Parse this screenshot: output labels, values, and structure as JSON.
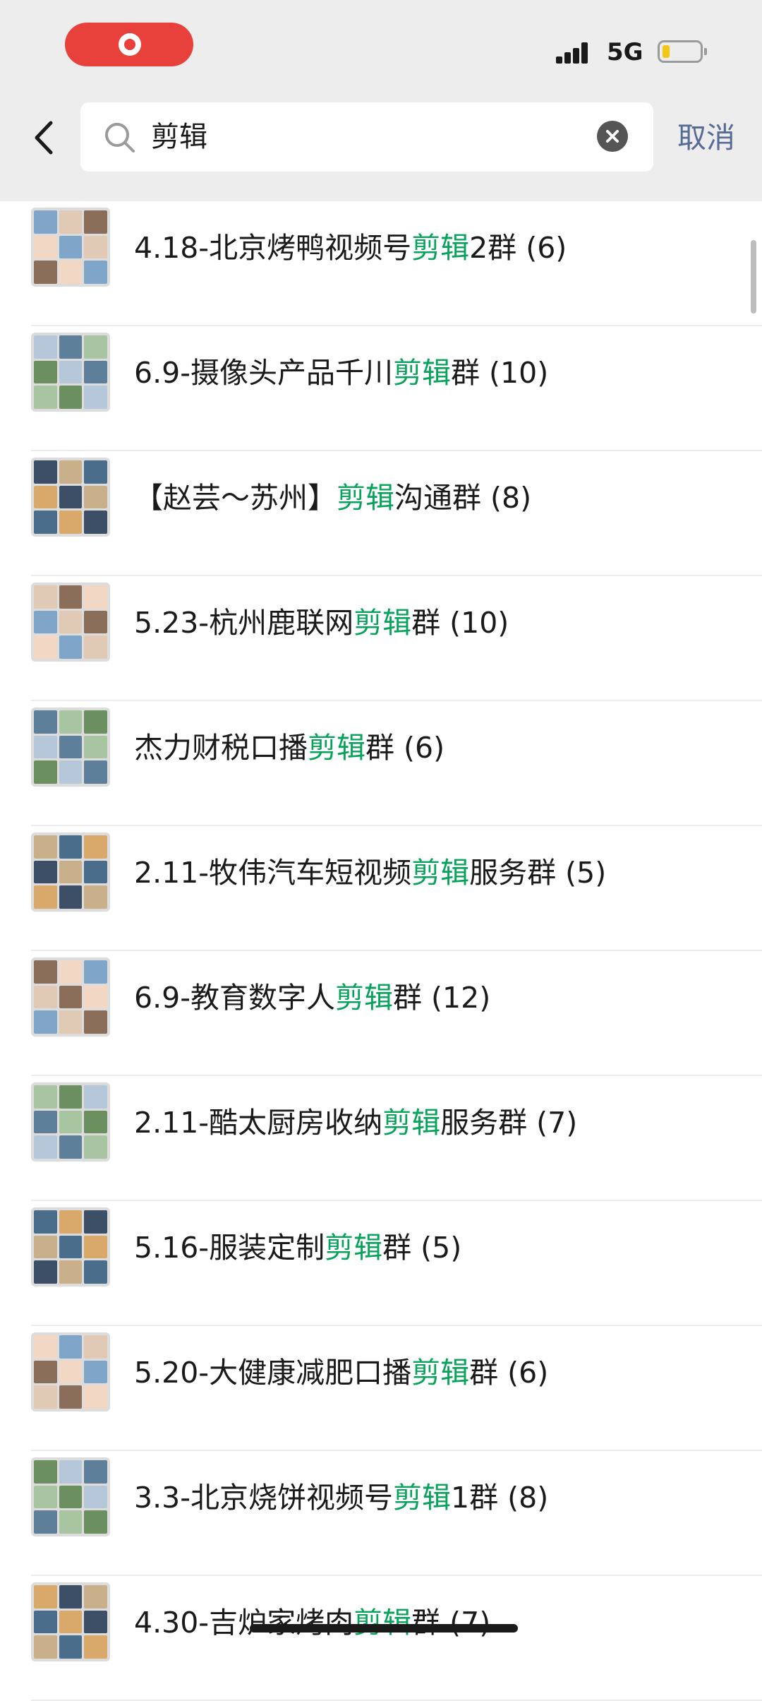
{
  "status_bar": {
    "network": "5G",
    "icons": [
      "record-icon",
      "signal-icon",
      "battery-icon"
    ],
    "battery_level": 0.2
  },
  "search": {
    "query": "剪辑",
    "cancel_label": "取消",
    "icons": [
      "back-icon",
      "search-icon",
      "clear-icon"
    ]
  },
  "colors": {
    "highlight": "#07a35a",
    "cancel": "#576b95",
    "record": "#e8403a",
    "background": "#ededed"
  },
  "results": [
    {
      "prefix": "4.18-北京烤鸭视频号",
      "keyword": "剪辑",
      "suffix": "2群 (6)"
    },
    {
      "prefix": "6.9-摄像头产品千川",
      "keyword": "剪辑",
      "suffix": "群 (10)"
    },
    {
      "prefix": "【赵芸～苏州】",
      "keyword": "剪辑",
      "suffix": "沟通群 (8)"
    },
    {
      "prefix": "5.23-杭州鹿联网",
      "keyword": "剪辑",
      "suffix": "群 (10)"
    },
    {
      "prefix": "杰力财税口播",
      "keyword": "剪辑",
      "suffix": "群 (6)"
    },
    {
      "prefix": "2.11-牧伟汽车短视频",
      "keyword": "剪辑",
      "suffix": "服务群 (5)"
    },
    {
      "prefix": "6.9-教育数字人",
      "keyword": "剪辑",
      "suffix": "群 (12)"
    },
    {
      "prefix": "2.11-酷太厨房收纳",
      "keyword": "剪辑",
      "suffix": "服务群 (7)"
    },
    {
      "prefix": "5.16-服装定制",
      "keyword": "剪辑",
      "suffix": "群 (5)"
    },
    {
      "prefix": "5.20-大健康减肥口播",
      "keyword": "剪辑",
      "suffix": "群 (6)"
    },
    {
      "prefix": "3.3-北京烧饼视频号",
      "keyword": "剪辑",
      "suffix": "1群 (8)"
    },
    {
      "prefix": "4.30-吉炉家烤肉",
      "keyword": "剪辑",
      "suffix": "群 (7)"
    }
  ]
}
